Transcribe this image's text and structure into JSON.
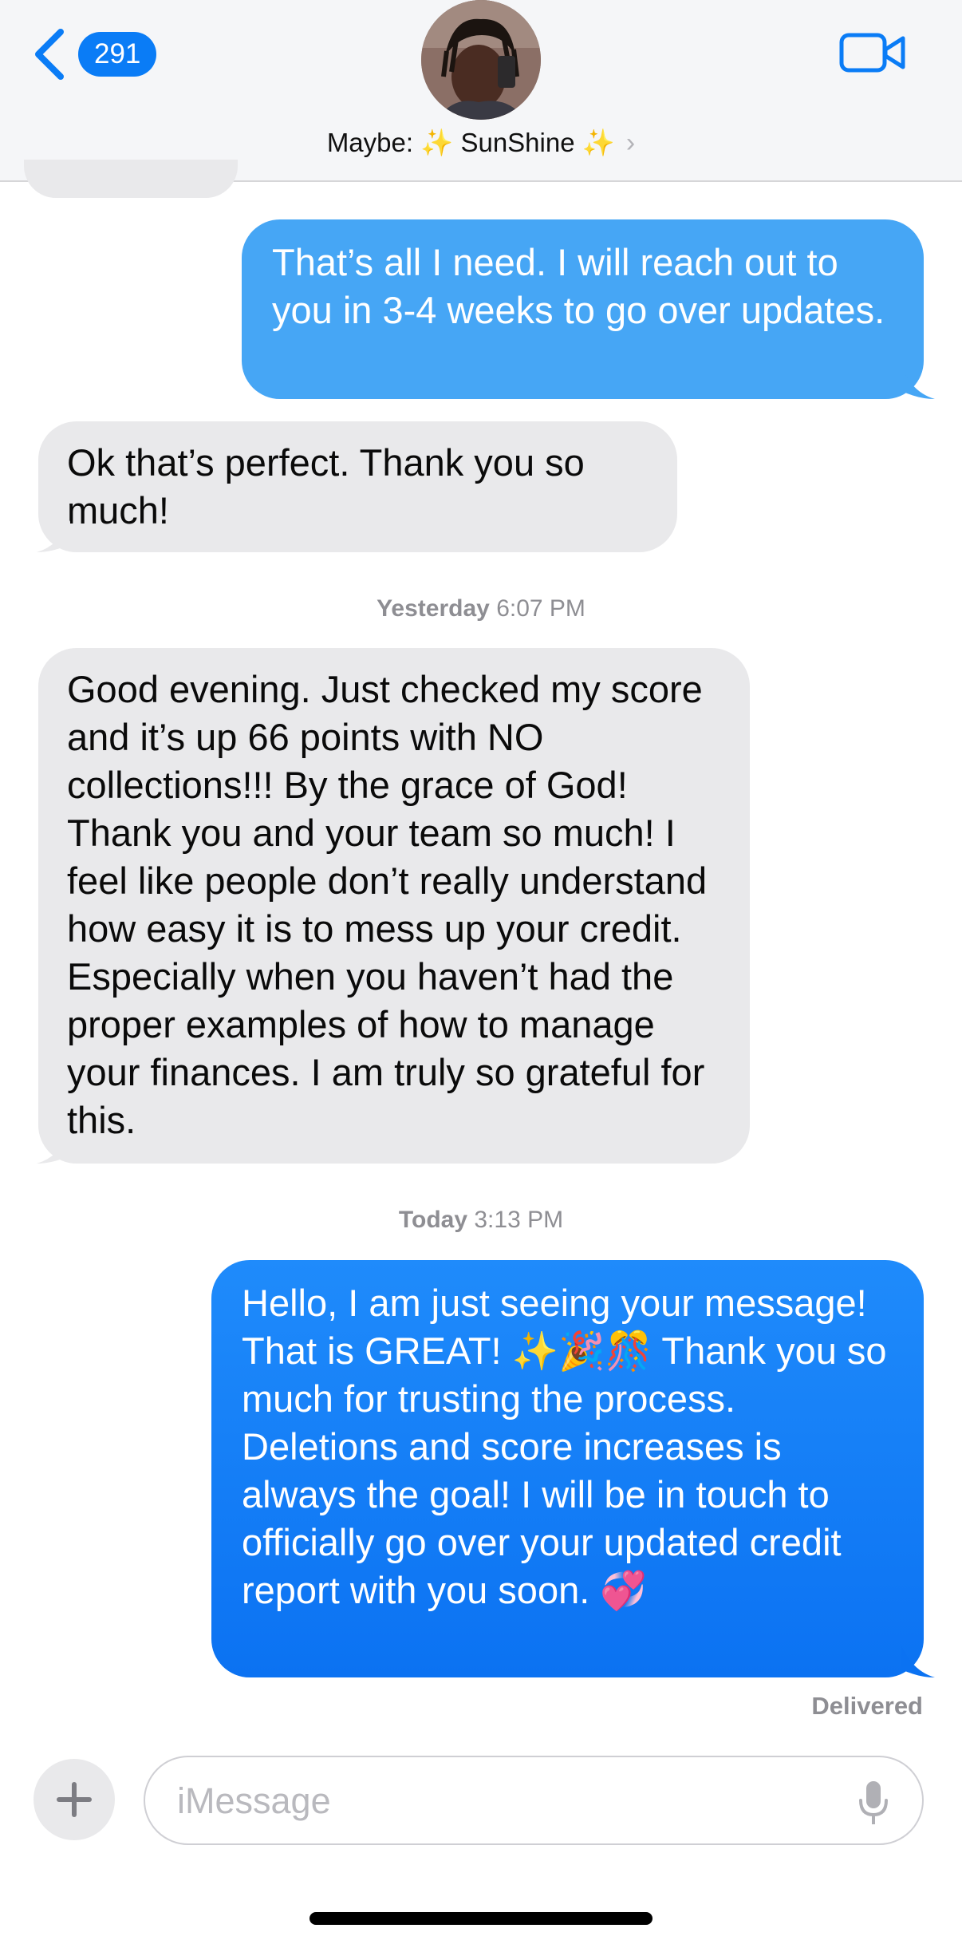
{
  "nav": {
    "back_count": "291",
    "contact_name": "Maybe: ✨ SunShine ✨",
    "contact_chevron": "›"
  },
  "messages": [
    {
      "side": "outgoing",
      "text": "That’s all I need. I will reach out to you in 3-4 weeks to go over updates."
    },
    {
      "side": "incoming",
      "text": "Ok that’s perfect. Thank you so much!"
    },
    {
      "side": "incoming",
      "text": "Good evening. Just checked my score and it’s up 66 points with NO collections!!! By the grace of God! Thank you and your team so much! I feel like people don’t really understand how easy it is to mess up your credit. Especially when you haven’t had the proper examples of how to manage your finances. I am truly so grateful for this."
    },
    {
      "side": "outgoing",
      "text": "Hello, I am just seeing your message! That is GREAT! ✨🎉🎊 Thank you so much for trusting the process. Deletions and score increases is always the goal! I will be in touch to officially go over your updated credit report with you soon. 💞"
    }
  ],
  "timestamps": [
    {
      "day": "Yesterday",
      "time": "6:07 PM"
    },
    {
      "day": "Today",
      "time": "3:13 PM"
    }
  ],
  "status": "Delivered",
  "compose": {
    "placeholder": "iMessage"
  },
  "colors": {
    "accent": "#0a7cf6",
    "outgoing_light": "#46a6f5",
    "outgoing_dark": "#0b72f2",
    "incoming": "#e9e9eb"
  },
  "icons": [
    "chevron-left-icon",
    "video-camera-icon",
    "plus-icon",
    "microphone-icon"
  ]
}
